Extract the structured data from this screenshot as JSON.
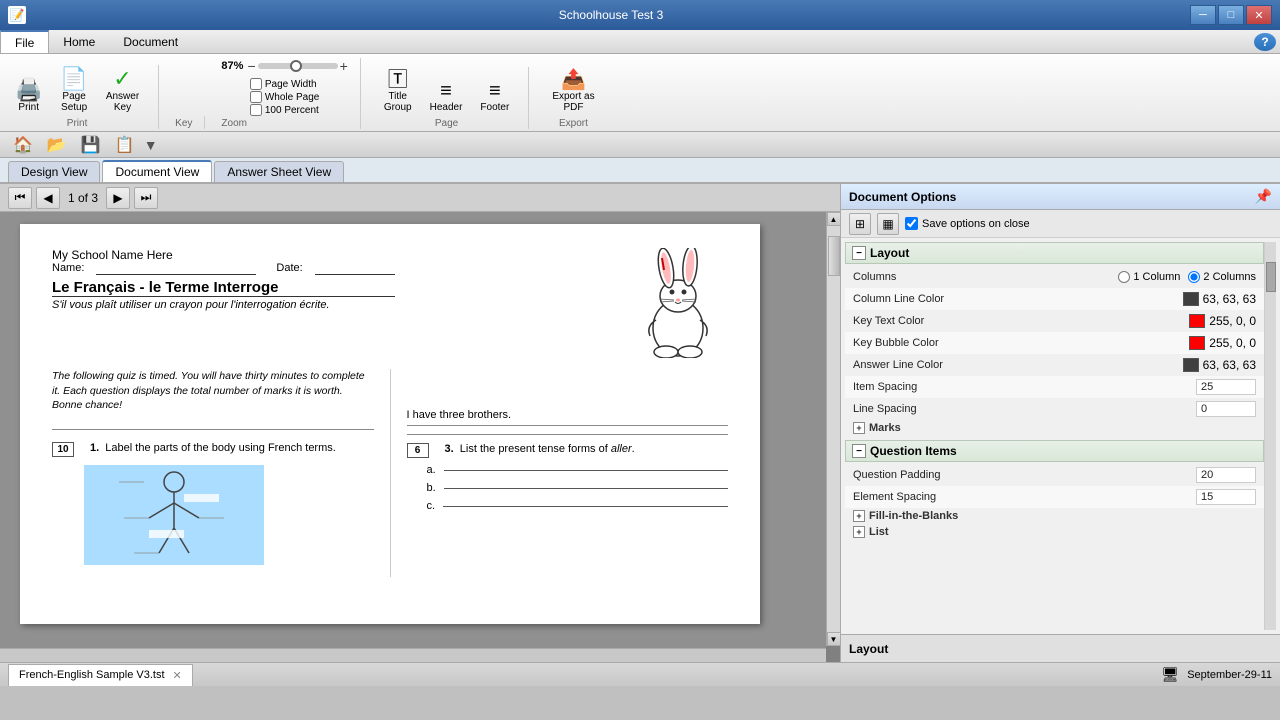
{
  "app": {
    "title": "Schoolhouse Test 3",
    "icon": "📝"
  },
  "window_controls": {
    "minimize": "─",
    "maximize": "□",
    "close": "✕"
  },
  "menu_tabs": [
    {
      "id": "file",
      "label": "File",
      "active": true
    },
    {
      "id": "home",
      "label": "Home",
      "active": false
    },
    {
      "id": "document",
      "label": "Document",
      "active": false
    }
  ],
  "ribbon": {
    "print_group": {
      "label": "Print",
      "buttons": [
        {
          "id": "print",
          "icon": "🖨",
          "label": "Print"
        },
        {
          "id": "page-setup",
          "icon": "📄",
          "label": "Page\nSetup"
        },
        {
          "id": "answer-key",
          "icon": "✓",
          "label": "Answer\nKey"
        }
      ]
    },
    "key_group": {
      "label": "Key",
      "buttons": []
    },
    "zoom_group": {
      "label": "Zoom",
      "value": "87%",
      "options": [
        {
          "id": "page-width",
          "label": "Page Width",
          "checked": false
        },
        {
          "id": "whole-page",
          "label": "Whole Page",
          "checked": false
        },
        {
          "id": "100-percent",
          "label": "100 Percent",
          "checked": false
        }
      ]
    },
    "page_group": {
      "label": "Page",
      "buttons": [
        {
          "id": "title-group",
          "icon": "T",
          "label": "Title\nGroup"
        },
        {
          "id": "header",
          "icon": "≡",
          "label": "Header"
        },
        {
          "id": "footer",
          "icon": "≡",
          "label": "Footer"
        },
        {
          "id": "export-pdf",
          "icon": "📤",
          "label": "Export as\nPDF"
        }
      ]
    },
    "export_group": {
      "label": "Export"
    }
  },
  "quick_access": {
    "buttons": [
      "🏠",
      "📂",
      "💾",
      "📋",
      "▼"
    ]
  },
  "view_tabs": [
    {
      "id": "design-view",
      "label": "Design View",
      "active": false
    },
    {
      "id": "document-view",
      "label": "Document View",
      "active": true
    },
    {
      "id": "answer-sheet-view",
      "label": "Answer Sheet View",
      "active": false
    }
  ],
  "page_nav": {
    "current": "1",
    "total": "3",
    "display": "1 of 3"
  },
  "document": {
    "school_name": "My School Name Here",
    "name_label": "Name:",
    "date_label": "Date:",
    "title": "Le Français - le Terme Interroge",
    "subtitle": "S'il vous plaît utiliser un crayon pour l'interrogation écrite.",
    "instructions": "The following quiz is timed. You will have thirty minutes to complete it. Each question displays the total number of marks it is worth. Bonne chance!",
    "questions": [
      {
        "id": "q1",
        "number": "1.",
        "marks": "10",
        "text": "Label the parts of the body using French terms."
      },
      {
        "id": "q3",
        "number": "3.",
        "marks": "6",
        "text": "List the present tense forms of aller.",
        "sentence": "I have three brothers.",
        "sub_items": [
          "a.",
          "b.",
          "c."
        ]
      }
    ]
  },
  "right_panel": {
    "title": "Document Options",
    "save_label": "Save options on close",
    "tools": [
      "🔲",
      "▦"
    ],
    "sections": [
      {
        "id": "layout",
        "title": "Layout",
        "expanded": true,
        "rows": [
          {
            "id": "columns",
            "label": "Columns",
            "type": "radio",
            "options": [
              {
                "id": "col1",
                "label": "1 Column",
                "selected": false
              },
              {
                "id": "col2",
                "label": "2 Columns",
                "selected": true
              }
            ]
          },
          {
            "id": "column-line-color",
            "label": "Column Line Color",
            "type": "color",
            "color": "#3f3f3f",
            "value": "63, 63, 63"
          },
          {
            "id": "key-text-color",
            "label": "Key Text Color",
            "type": "color",
            "color": "#ff0000",
            "value": "255, 0, 0"
          },
          {
            "id": "key-bubble-color",
            "label": "Key Bubble Color",
            "type": "color",
            "color": "#ff0000",
            "value": "255, 0, 0"
          },
          {
            "id": "answer-line-color",
            "label": "Answer Line Color",
            "type": "color",
            "color": "#3f3f3f",
            "value": "63, 63, 63"
          },
          {
            "id": "item-spacing",
            "label": "Item Spacing",
            "type": "number",
            "value": "25"
          },
          {
            "id": "line-spacing",
            "label": "Line Spacing",
            "type": "number",
            "value": "0"
          }
        ],
        "sub_sections": [
          {
            "id": "marks",
            "title": "Marks",
            "toggle": "+"
          }
        ]
      },
      {
        "id": "question-items",
        "title": "Question Items",
        "expanded": true,
        "rows": [
          {
            "id": "question-padding",
            "label": "Question Padding",
            "type": "number",
            "value": "20"
          },
          {
            "id": "element-spacing",
            "label": "Element Spacing",
            "type": "number",
            "value": "15"
          }
        ],
        "sub_sections": [
          {
            "id": "fill-in-blanks",
            "title": "Fill-in-the-Blanks",
            "toggle": "+"
          },
          {
            "id": "list",
            "title": "List",
            "toggle": "+"
          }
        ]
      }
    ],
    "bottom_label": "Layout"
  },
  "status_bar": {
    "file_tab": "French-English Sample V3.tst",
    "datetime": "September-29-11",
    "icon": "🖥"
  }
}
